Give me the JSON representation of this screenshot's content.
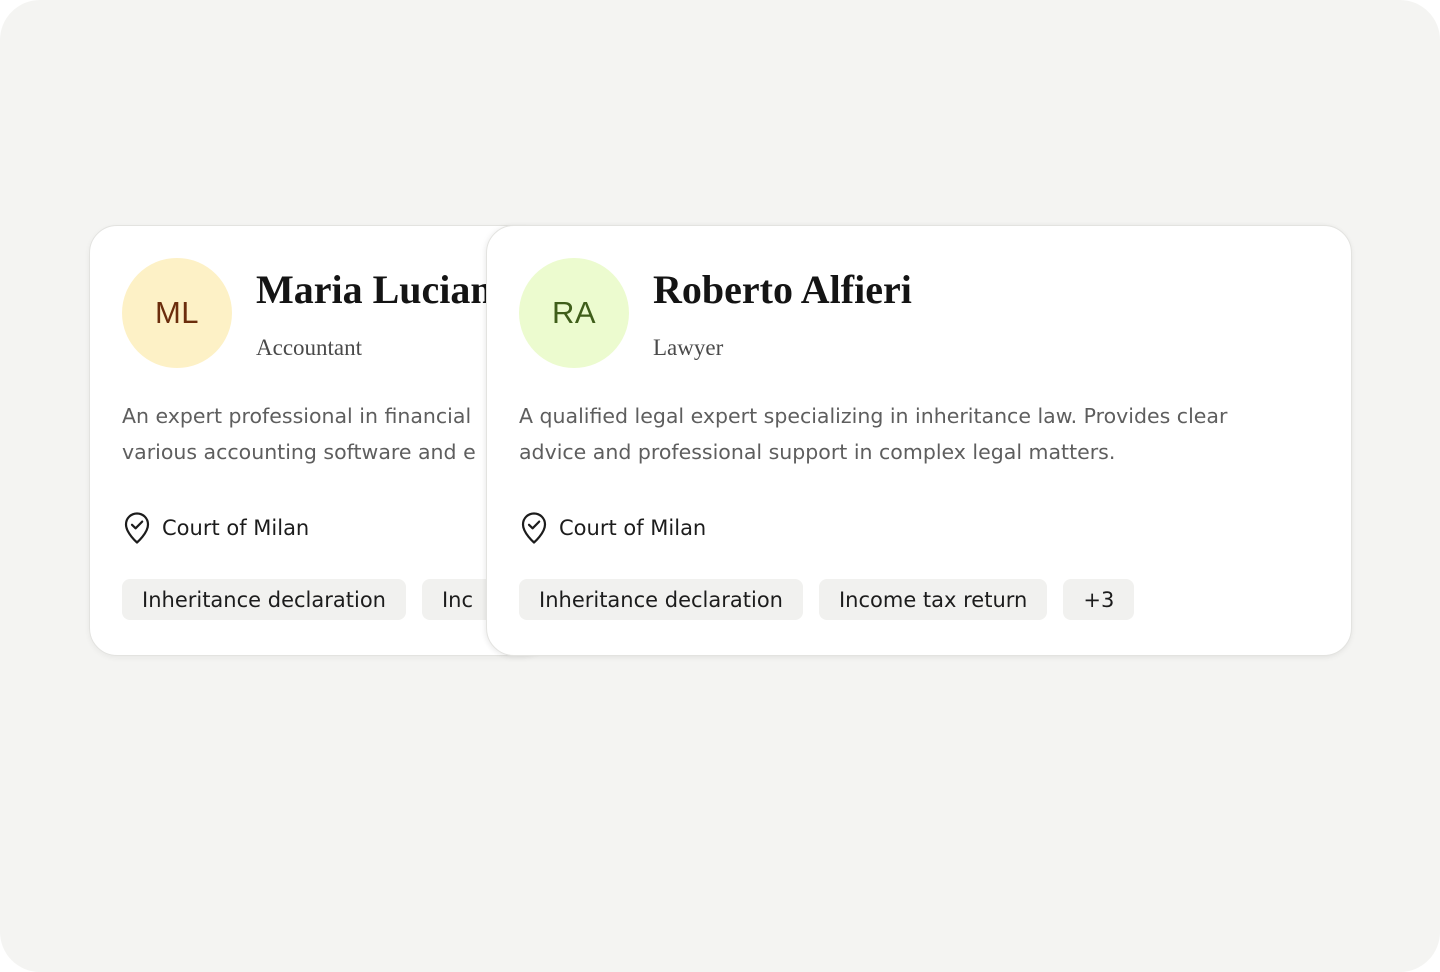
{
  "cards": [
    {
      "initials": "ML",
      "avatar_bg": "#fdf1c6",
      "avatar_fg": "#6b2d0c",
      "name": "Maria Luciani",
      "role": "Accountant",
      "description_lines": [
        "An expert professional in financial",
        "various accounting software and e"
      ],
      "location": "Court of Milan",
      "tags": [
        "Inheritance declaration",
        "Inc"
      ]
    },
    {
      "initials": "RA",
      "avatar_bg": "#ecfbcf",
      "avatar_fg": "#3f5e1a",
      "name": "Roberto Alfieri",
      "role": "Lawyer",
      "description_lines": [
        "A qualified legal expert specializing in inheritance law. Provides clear",
        "advice and professional support in complex legal matters."
      ],
      "location": "Court of Milan",
      "tags": [
        "Inheritance declaration",
        "Income tax return",
        "+3"
      ]
    }
  ],
  "icons": {
    "location": "location-check-icon"
  }
}
